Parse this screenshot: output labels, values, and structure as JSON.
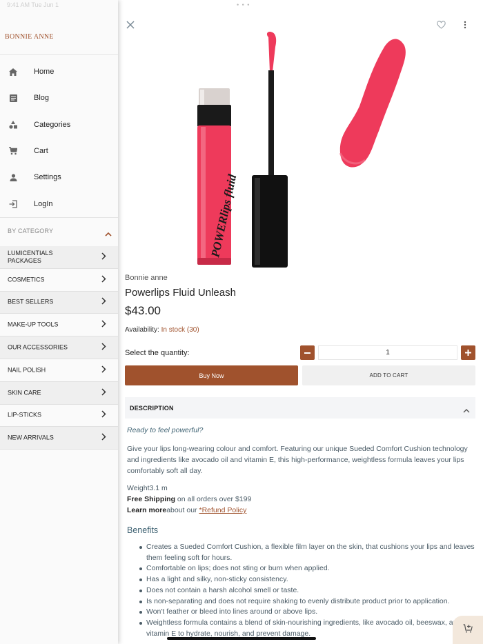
{
  "statusbar": {
    "time": "9:41 AM  Tue Jun 1"
  },
  "sidebar": {
    "brand": "BONNIE ANNE",
    "nav": [
      {
        "label": "Home",
        "icon": "home-icon"
      },
      {
        "label": "Blog",
        "icon": "blog-icon"
      },
      {
        "label": "Categories",
        "icon": "categories-icon"
      },
      {
        "label": "Cart",
        "icon": "cart-icon"
      },
      {
        "label": "Settings",
        "icon": "person-icon"
      },
      {
        "label": "LogIn",
        "icon": "login-icon"
      }
    ],
    "by_category": "BY CATEGORY",
    "categories": [
      {
        "label": "LUMICENTIALS PACKAGES"
      },
      {
        "label": "COSMETICS"
      },
      {
        "label": "BEST SELLERS"
      },
      {
        "label": "MAKE-UP TOOLS"
      },
      {
        "label": "OUR ACCESSORIES"
      },
      {
        "label": "NAIL POLISH"
      },
      {
        "label": "SKIN CARE"
      },
      {
        "label": "LIP-STICKS"
      },
      {
        "label": "NEW ARRIVALS"
      }
    ]
  },
  "product": {
    "brand": "Bonnie anne",
    "title": "Powerlips Fluid Unleash",
    "price": "$43.00",
    "availability_label": "Availability:",
    "stock_text": "In stock",
    "stock_count": "(30)",
    "quantity_label": "Select the quantity:",
    "quantity": "1",
    "buy_now": "Buy Now",
    "add_to_cart": "ADD TO CART",
    "tube_text": "POWERlips fluid",
    "colors": {
      "accent": "#a0522d",
      "lipstick": "#ee3a5b"
    }
  },
  "description": {
    "heading": "DESCRIPTION",
    "tagline": "Ready to feel powerful?",
    "body": "Give your lips long-wearing colour and comfort. Featuring our unique Sueded Comfort Cushion technology and ingredients like avocado oil and vitamin E, this high-performance, weightless formula leaves your lips comfortably soft all day.",
    "weight": "Weight3.1 m",
    "free_shipping_bold": "Free Shipping",
    "free_shipping_rest": " on all orders over $199",
    "learn_more_bold": "Learn more",
    "learn_more_rest": "about our ",
    "refund_link": "*Refund Policy",
    "benefits_title": "Benefits",
    "benefits": [
      "Creates a Sueded Comfort Cushion, a flexible film layer on the skin, that cushions your lips and leaves them feeling soft for hours.",
      "Comfortable on lips; does not sting or burn when applied.",
      "Has a light and silky, non-sticky consistency.",
      "Does not contain a harsh alcohol smell or taste.",
      "Is non-separating and does not require shaking to evenly distribute product prior to application.",
      "Won't feather or bleed into lines around or above lips.",
      "Weightless formula contains a blend of skin-nourishing ingredients, like avocado oil, beeswax, and vitamin E to hydrate, nourish, and prevent damage."
    ]
  }
}
